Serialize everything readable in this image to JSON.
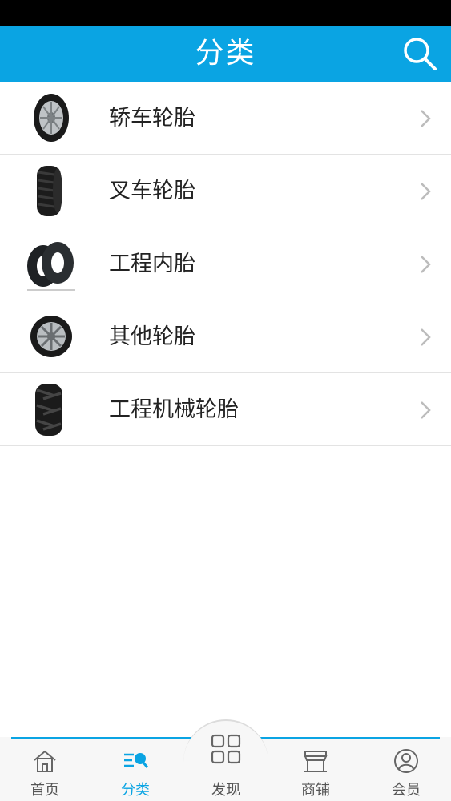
{
  "header": {
    "title": "分类",
    "search_icon": "search-icon"
  },
  "categories": [
    {
      "label": "轿车轮胎",
      "thumb": "car-tire-image"
    },
    {
      "label": "叉车轮胎",
      "thumb": "forklift-tire-image"
    },
    {
      "label": "工程内胎",
      "thumb": "inner-tube-image"
    },
    {
      "label": "其他轮胎",
      "thumb": "wheel-tire-image"
    },
    {
      "label": "工程机械轮胎",
      "thumb": "engineering-tire-image"
    }
  ],
  "tabbar": {
    "items": [
      {
        "label": "首页",
        "icon": "home-icon"
      },
      {
        "label": "分类",
        "icon": "category-icon",
        "active": true
      },
      {
        "label": "发现",
        "icon": "grid-icon"
      },
      {
        "label": "商铺",
        "icon": "shop-icon"
      },
      {
        "label": "会员",
        "icon": "user-icon"
      }
    ]
  },
  "colors": {
    "accent": "#0aa4e3",
    "text": "#222222",
    "divider": "#e3e3e3"
  }
}
